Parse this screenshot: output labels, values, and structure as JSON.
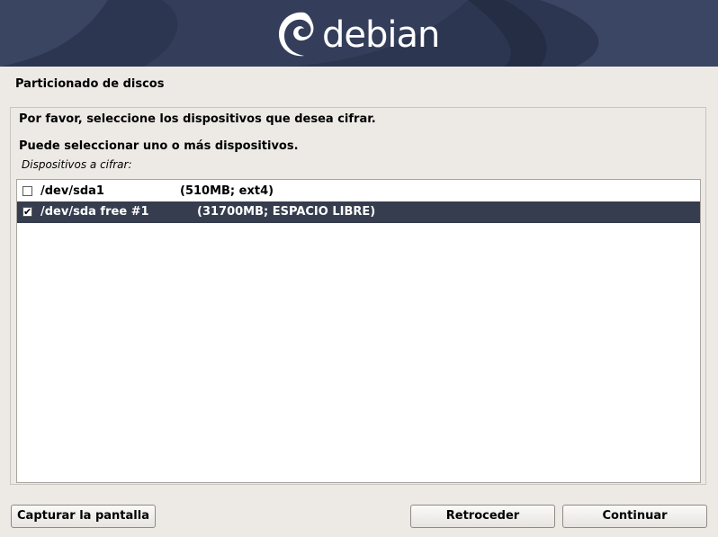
{
  "banner": {
    "logo_text": "debian",
    "logo_icon": "debian-swirl-icon",
    "background_color": "#2c3650"
  },
  "page": {
    "title": "Particionado de discos"
  },
  "dialog": {
    "question": "Por favor, seleccione los dispositivos que desea cifrar.",
    "hint": "Puede seleccionar uno o más dispositivos.",
    "list_label": "Dispositivos a cifrar:",
    "devices": [
      {
        "device": "/dev/sda1",
        "info": "(510MB; ext4)",
        "checked": false,
        "selected": false
      },
      {
        "device": "/dev/sda free #1",
        "info": "(31700MB; ESPACIO LIBRE)",
        "checked": true,
        "selected": true
      }
    ],
    "selection_color": "#353d4e"
  },
  "buttons": {
    "screenshot": "Capturar la pantalla",
    "back": "Retroceder",
    "continue": "Continuar"
  },
  "icons": {
    "checked": "✔",
    "unchecked": ""
  }
}
